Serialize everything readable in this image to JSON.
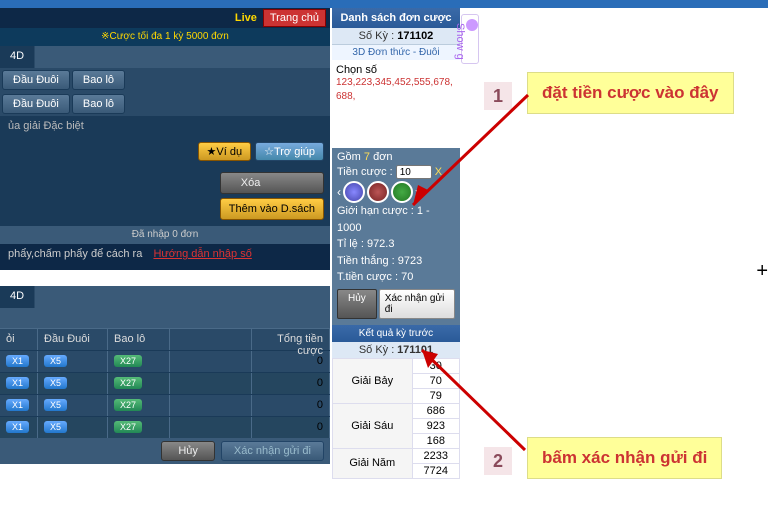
{
  "header": {
    "live": "Live",
    "home_btn": "Trang chủ",
    "limit_text": "※Cược tối đa 1 kỳ 5000 đơn"
  },
  "tabs": {
    "tab4d": "4D"
  },
  "subtabs": {
    "dau_duoi": "Đầu Đuôi",
    "bao_lo": "Bao lô",
    "dau_duoi2": "Đầu Đuôi",
    "bao_lo2": "Bao lô"
  },
  "section_special": "ủa giải Đặc biệt",
  "help_btns": {
    "vidu": "★Ví dụ",
    "troguip": "☆Trợ giúp"
  },
  "action_btns": {
    "xoa": "Xóa",
    "them": "Thêm vào D.sách"
  },
  "status_entered": "Đã nhập 0 đơn",
  "hint_text": "phẩy,chấm phẩy để cách ra",
  "hint_link": "Hướng dẫn nhập số",
  "betlist": {
    "tab4d": "4D",
    "col_dau": "Đầu Đuôi",
    "col_bao": "Bao lô",
    "col_total": "Tổng tiền cược",
    "x1": "X1",
    "x5": "X5",
    "x27": "X27",
    "zero": "0"
  },
  "footer": {
    "huy": "Hủy",
    "confirm": "Xác nhận gửi đi"
  },
  "rp": {
    "title": "Danh sách đơn cược",
    "soky_label": "Số Kỳ :",
    "soky": "171102",
    "type": "3D Đơn thức - Đuôi",
    "chon": "Chọn số",
    "nums": "123,223,345,452,555,678,688,",
    "gom_pre": "Gồm ",
    "gom_n": "7",
    "gom_post": " đơn",
    "tien_label": "Tiền cược :",
    "tien_value": "10",
    "x": "X",
    "range": "Giới hạn cược : 1 - 1000",
    "ti": "Tỉ       lệ : 972.3",
    "thang": "Tiền thắng : 9723",
    "tcuoc": "T.tiền cược : 70",
    "huy": "Hủy",
    "confirm": "Xác nhận gửi đi",
    "results_title": "Kết quả kỳ trước",
    "soky_prev_label": "Số Kỳ :",
    "soky_prev": "171101",
    "giai_bay": "Giải Bảy",
    "giai_sau": "Giải Sáu",
    "giai_nam": "Giải Năm",
    "r": [
      "30",
      "70",
      "79",
      "686",
      "923",
      "168",
      "2233",
      "7724"
    ]
  },
  "show_tab": "Show g",
  "annot": {
    "a1": "đặt tiền cược vào đây",
    "a2": "bấm xác nhận gửi đi",
    "n1": "1",
    "n2": "2"
  },
  "plus": "+"
}
